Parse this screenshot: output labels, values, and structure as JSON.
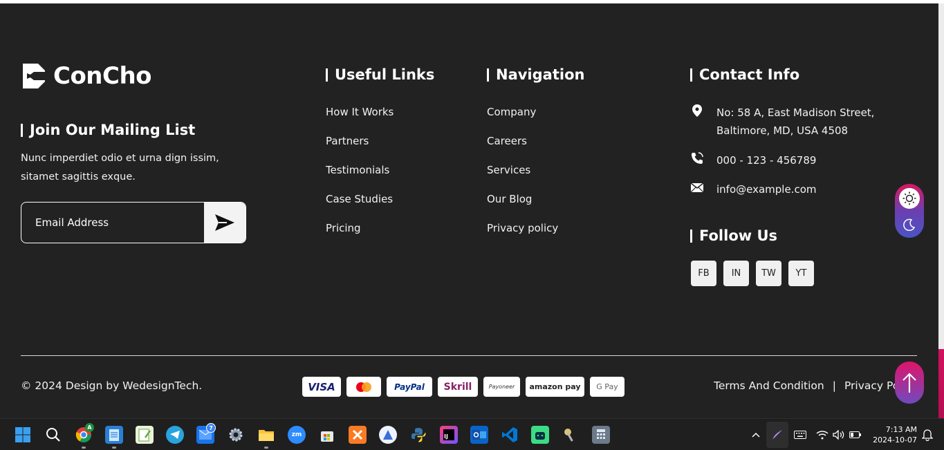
{
  "brand": {
    "name": "ConCho"
  },
  "mailing": {
    "heading": "Join Our Mailing List",
    "description": "Nunc imperdiet odio et urna dign issim, sitamet sagittis exque.",
    "email_placeholder": "Email Address"
  },
  "useful_links": {
    "heading": "Useful Links",
    "items": [
      "How It Works",
      "Partners",
      "Testimonials",
      "Case Studies",
      "Pricing"
    ]
  },
  "navigation": {
    "heading": "Navigation",
    "items": [
      "Company",
      "Careers",
      "Services",
      "Our Blog",
      "Privacy policy"
    ]
  },
  "contact": {
    "heading": "Contact Info",
    "address_line1": "No: 58 A, East Madison Street,",
    "address_line2": "Baltimore, MD, USA 4508",
    "phone": "000 - 123 - 456789",
    "email": "info@example.com"
  },
  "follow": {
    "heading": "Follow Us",
    "socials": [
      "FB",
      "IN",
      "TW",
      "YT"
    ]
  },
  "bottom": {
    "copyright": "© 2024 Design by WedesignTech.",
    "payments": [
      "VISA",
      "mastercard",
      "PayPal",
      "Skrill",
      "Payoneer",
      "amazon pay",
      "G Pay"
    ],
    "terms": "Terms And Condition",
    "separator": "|",
    "privacy": "Privacy Policy"
  },
  "taskbar": {
    "apps": [
      "windows-start",
      "search",
      "chrome",
      "notepad",
      "notepad-plus",
      "telegram",
      "mail",
      "settings",
      "file-explorer",
      "zoom",
      "microsoft-store",
      "xampp",
      "app-launcher",
      "python",
      "intellij",
      "outlook",
      "vscode",
      "android-studio",
      "keys",
      "calculator"
    ],
    "mail_badge": "7",
    "chrome_badge": "A",
    "time": "7:13 AM",
    "date": "2024-10-07"
  },
  "colors": {
    "background": "#222222",
    "accent_pink": "#d8185f",
    "accent_purple": "#6b3fb0",
    "text": "#ffffff"
  }
}
